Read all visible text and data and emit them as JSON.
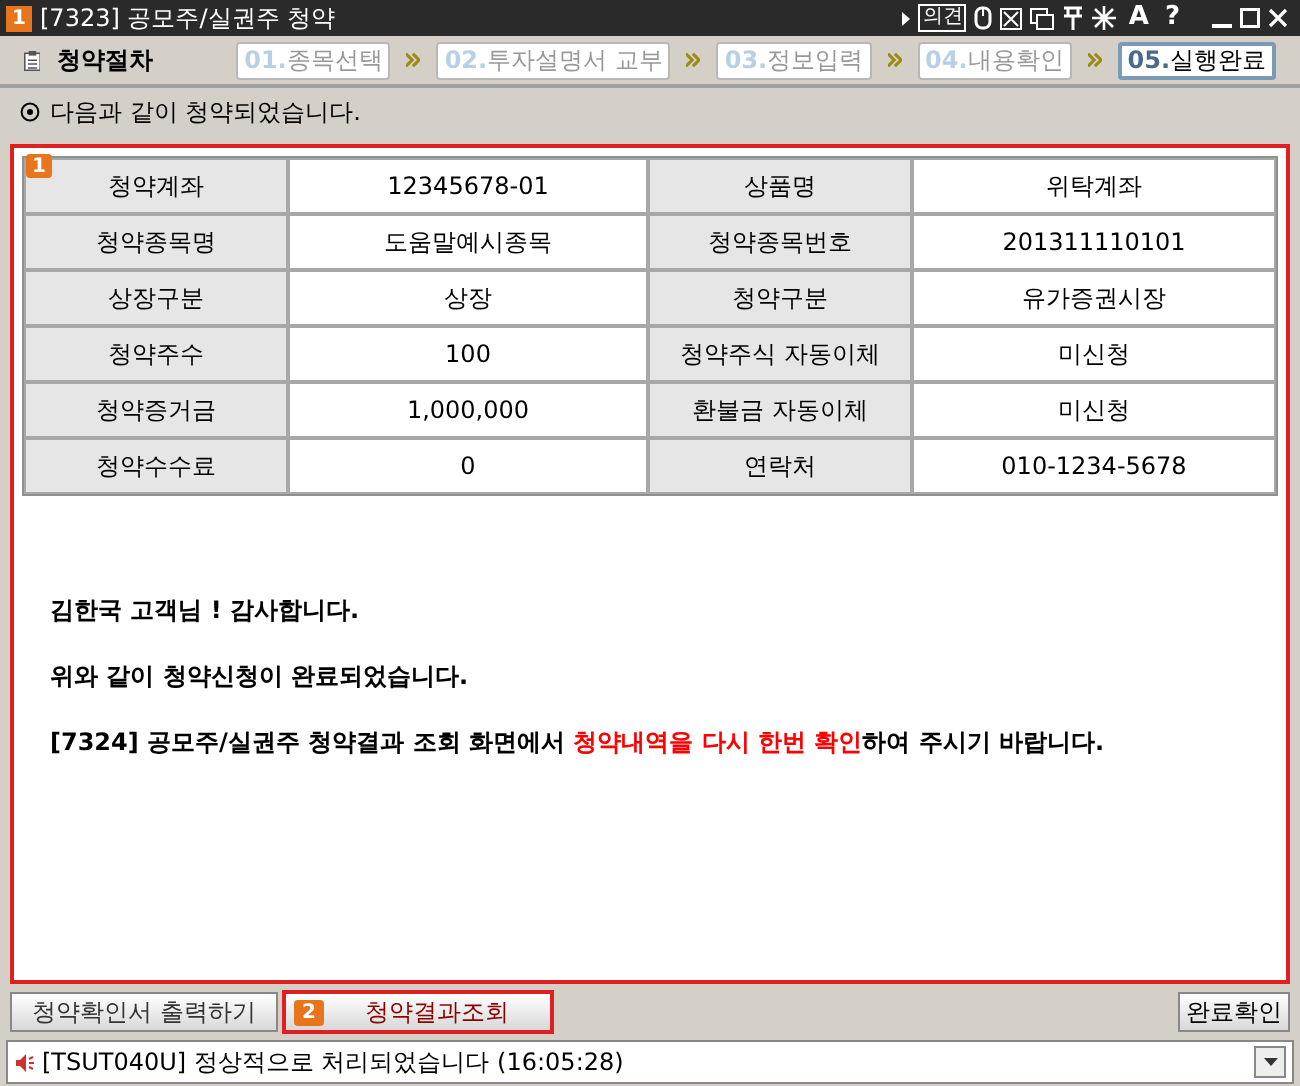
{
  "window": {
    "badge": "1",
    "title": "[7323] 공모주/실권주 청약",
    "opinion_button": "의견",
    "glyph_buttons": [
      "A",
      "?"
    ]
  },
  "procedure": {
    "title": "청약절차",
    "steps": [
      {
        "number": "01.",
        "label": "종목선택",
        "selected": false
      },
      {
        "number": "02.",
        "label": "투자설명서 교부",
        "selected": false
      },
      {
        "number": "03.",
        "label": "정보입력",
        "selected": false
      },
      {
        "number": "04.",
        "label": "내용확인",
        "selected": false
      },
      {
        "number": "05.",
        "label": "실행완료",
        "selected": true
      }
    ]
  },
  "notice": "다음과 같이 청약되었습니다.",
  "panel": {
    "badge": "1",
    "rows": [
      [
        "청약계좌",
        "12345678-01",
        "상품명",
        "위탁계좌"
      ],
      [
        "청약종목명",
        "도움말예시종목",
        "청약종목번호",
        "201311110101"
      ],
      [
        "상장구분",
        "상장",
        "청약구분",
        "유가증권시장"
      ],
      [
        "청약주수",
        "100",
        "청약주식 자동이체",
        "미신청"
      ],
      [
        "청약증거금",
        "1,000,000",
        "환불금 자동이체",
        "미신청"
      ],
      [
        "청약수수료",
        "0",
        "연락처",
        "010-1234-5678"
      ]
    ],
    "messages": [
      [
        {
          "text": "김한국 고객님 !  감사합니다.",
          "highlight": false
        }
      ],
      [
        {
          "text": "위와 같이 청약신청이 완료되었습니다.",
          "highlight": false
        }
      ],
      [
        {
          "text": "[7324] 공모주/실권주 청약결과 조회 화면에서 ",
          "highlight": false
        },
        {
          "text": "청약내역을 다시 한번 확인",
          "highlight": true
        },
        {
          "text": "하여 주시기 바랍니다.",
          "highlight": false
        }
      ]
    ]
  },
  "buttons": {
    "print": "청약확인서 출력하기",
    "result_badge": "2",
    "result": "청약결과조회",
    "complete": "완료확인"
  },
  "status_bar": {
    "message": "[TSUT040U] 정상적으로 처리되었습니다 (16:05:28)"
  }
}
